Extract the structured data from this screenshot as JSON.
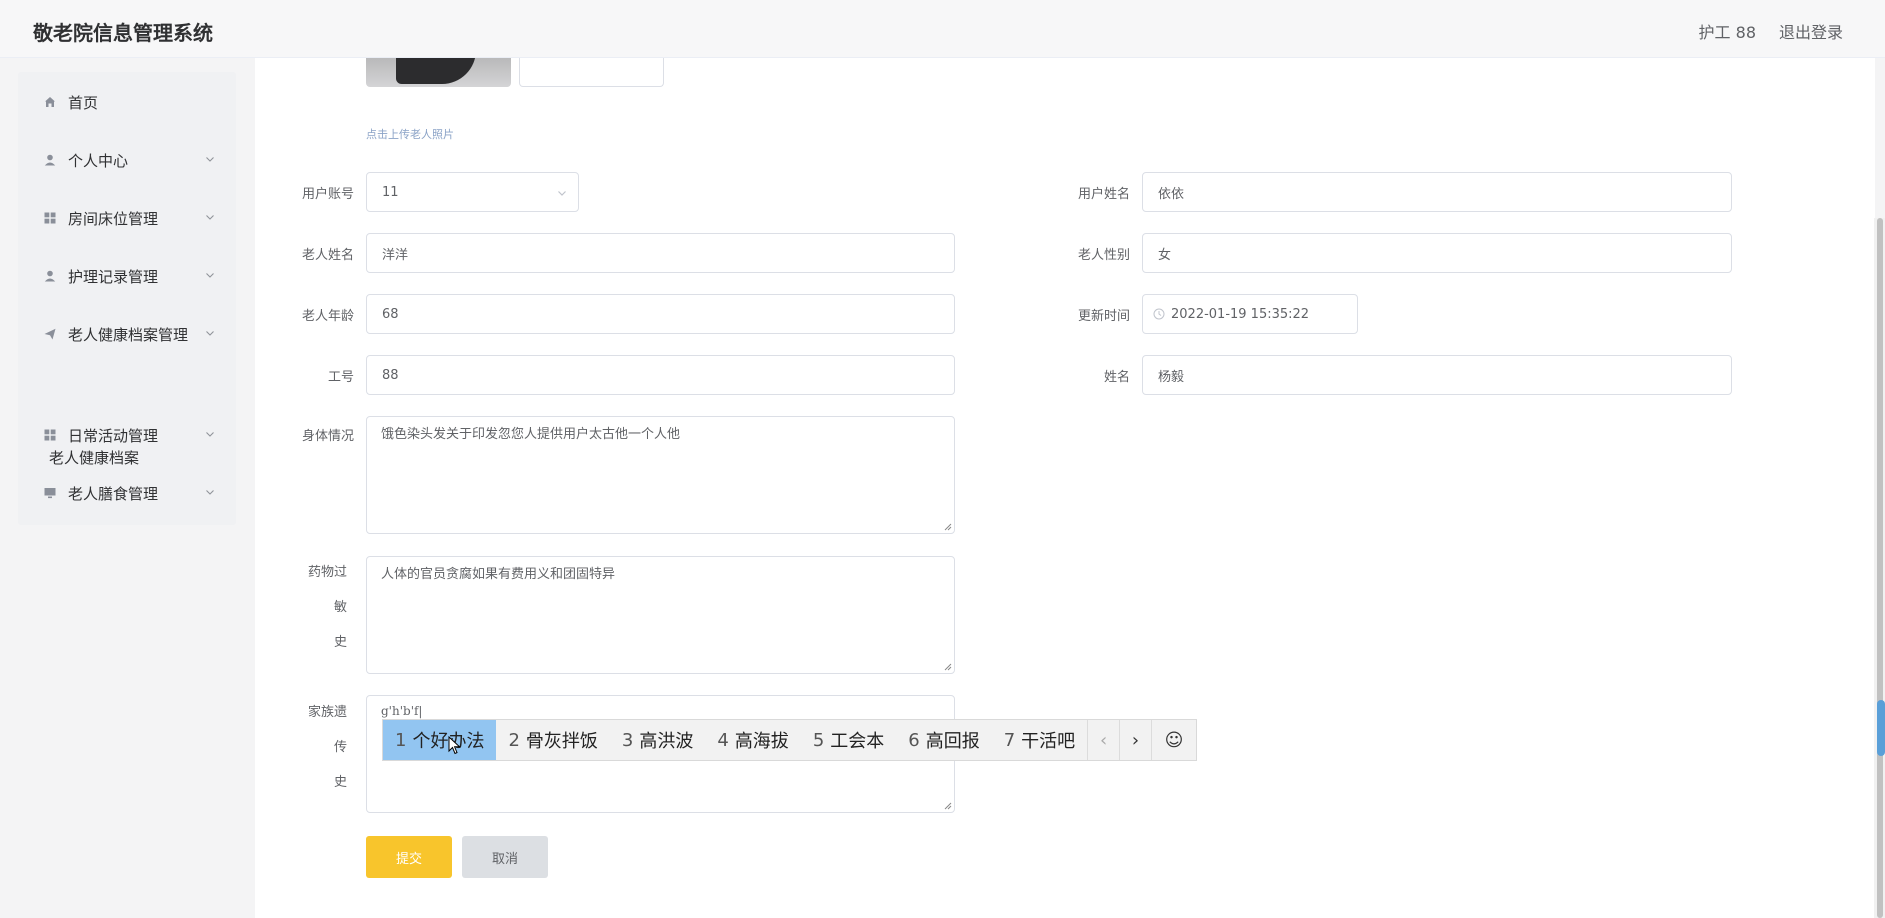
{
  "header": {
    "title": "敬老院信息管理系统",
    "user": "护工 88",
    "logout": "退出登录"
  },
  "sidebar": {
    "items": [
      {
        "label": "首页",
        "icon": "home-icon"
      },
      {
        "label": "个人中心",
        "icon": "user-icon"
      },
      {
        "label": "房间床位管理",
        "icon": "grid-icon"
      },
      {
        "label": "护理记录管理",
        "icon": "user-icon"
      },
      {
        "label": "老人健康档案管理",
        "icon": "send-icon"
      },
      {
        "label": "日常活动管理",
        "icon": "grid-icon"
      },
      {
        "label": "老人膳食管理",
        "icon": "monitor-icon"
      }
    ],
    "submenu": "老人健康档案"
  },
  "form": {
    "upload_hint": "点击上传老人照片",
    "account_label": "用户账号",
    "account_value": "11",
    "username_label": "用户姓名",
    "username_value": "依依",
    "elder_name_label": "老人姓名",
    "elder_name_value": "洋洋",
    "elder_gender_label": "老人性别",
    "elder_gender_value": "女",
    "elder_age_label": "老人年龄",
    "elder_age_value": "68",
    "update_time_label": "更新时间",
    "update_time_value": "2022-01-19 15:35:22",
    "staff_no_label": "工号",
    "staff_no_value": "88",
    "name_label": "姓名",
    "name_value": "杨毅",
    "health_label": "身体情况",
    "health_value": "饿色染头发关于印发忽您人提供用户太古他一个人他",
    "allergy_label_1": "药物过敏",
    "allergy_label_2": "史",
    "allergy_value": "人体的官员贪腐如果有费用义和团固特异",
    "family_label_1": "家族遗传",
    "family_label_2": "史",
    "family_value": "g'h'b'f|",
    "submit": "提交",
    "cancel": "取消"
  },
  "ime": {
    "candidates": [
      {
        "num": "1",
        "text": "个好办法"
      },
      {
        "num": "2",
        "text": "骨灰拌饭"
      },
      {
        "num": "3",
        "text": "高洪波"
      },
      {
        "num": "4",
        "text": "高海拔"
      },
      {
        "num": "5",
        "text": "工会本"
      },
      {
        "num": "6",
        "text": "高回报"
      },
      {
        "num": "7",
        "text": "干活吧"
      }
    ],
    "prev": "‹",
    "next": "›",
    "emoji": "☺"
  },
  "colors": {
    "accent": "#f8c52c",
    "ime_selected": "#92c5f1",
    "hint": "#8ba3c7"
  }
}
